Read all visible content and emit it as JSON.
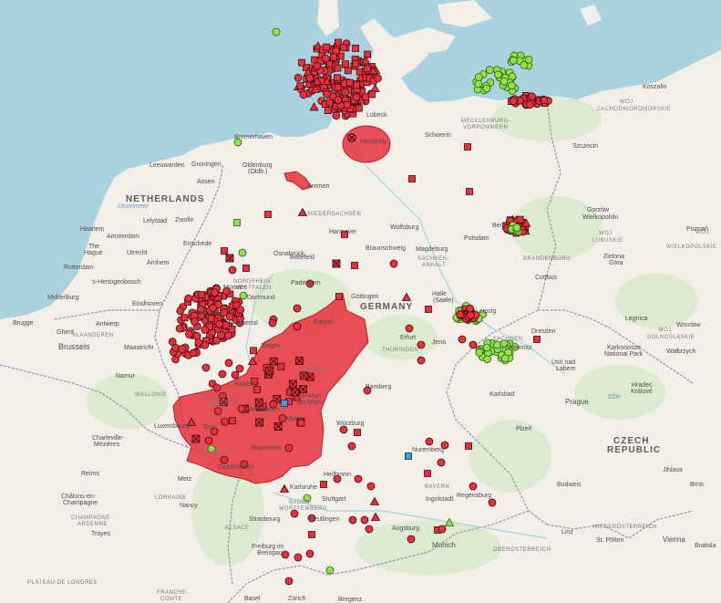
{
  "map": {
    "colors": {
      "sea": "#aad3df",
      "land": "#f2efe9",
      "forest": "#dcead0",
      "border": "#9b8fb5",
      "highlight_fill": "#e8303c",
      "marker_red": "#e8303c",
      "marker_green": "#8ee34a",
      "marker_blue": "#3aa0dd"
    },
    "marker_types": [
      "circle",
      "square",
      "triangle",
      "crossed-square"
    ],
    "countries": {
      "germany": "GERMANY",
      "netherlands": "NETHERLANDS",
      "czech1": "CZECH",
      "czech2": "REPUBLIC"
    },
    "regions": {
      "mecklenburg1": "MECKLENBURG-",
      "mecklenburg2": "VORPOMMERN",
      "zachodniopomorskie": "ZACHODNIOPOMORSKIE",
      "niedersachsen": "NIEDERSACHSEN",
      "brandenburg": "BRANDENBURG",
      "nordrhein1": "NORDRHEIN-",
      "nordrhein2": "WESTFALEN",
      "sachsen_anhalt1": "SACHSEN-",
      "sachsen_anhalt2": "ANHALT",
      "hessen": "HESSEN",
      "thuringen": "THÜRINGEN",
      "sachsen": "SACHSEN",
      "rheinland1": "RHEINLAND-",
      "rheinland2": "PFALZ",
      "saarland": "SAARLAND",
      "bayern": "BAYERN",
      "baden1": "BADEN-",
      "baden2": "WÜRTTEMBERG",
      "vlaanderen": "VLAANDEREN",
      "wallonie": "WALLONIE",
      "lorraine": "LORRAINE",
      "champagne1": "CHAMPAGNE-",
      "champagne2": "ARDENNE",
      "alsace": "ALSACE",
      "franche1": "FRANCHE-",
      "franche2": "COMTE",
      "plateau": "PLATEAU DE LONGRES",
      "woj1": "WOJ",
      "woj1b": "ZACHODNIOPOMORSKIE",
      "woj2": "WOJ",
      "woj2b": "WIELKOPOLSKIE",
      "woj3": "WOJ",
      "woj3b": "LUBUSKIE",
      "woj4": "WOJ",
      "woj4b": "DOLNOŚLĄSKIE",
      "niederosterreich": "NIEDERÖSTERREICH",
      "oberosterreich": "OBERÖSTERREICH"
    },
    "cities": {
      "bremerhaven": "Bremerhaven",
      "lubeck": "Lübeck",
      "hamburg": "Hamburg",
      "schwerin": "Schwerin",
      "szczecin": "Szczecin",
      "koszalin": "Koszalin",
      "leeuwarden": "Leeuwarden",
      "groningen": "Groningen",
      "oldenburg": "Oldenburg",
      "oldenburg2": "(Oldb.)",
      "assen": "Assen",
      "bremen": "Bremen",
      "haarlem": "Haarlem",
      "lelystad": "Lelystad",
      "zwolle": "Zwolle",
      "amsterdam": "Amsterdam",
      "hannover": "Hannover",
      "wolfsburg": "Wolfsburg",
      "berlin": "Berlin",
      "gorzow1": "Gorzów",
      "gorzow2": "Wielkopolski",
      "poznan": "Poznań",
      "thehague1": "The",
      "thehague2": "Hague",
      "utrecht": "Utrecht",
      "enschede": "Enschede",
      "osnabruck": "Osnabrück",
      "braunschweig": "Braunschweig",
      "magdeburg": "Magdeburg",
      "potsdam": "Potsdam",
      "rotterdam": "Rotterdam",
      "arnhem": "Arnhem",
      "bielefeld": "Bielefeld",
      "zielona1": "Zielona",
      "zielona2": "Góra",
      "hertogenbosch": "'s-Hertogenbosch",
      "munster": "Münster",
      "paderborn": "Paderborn",
      "gottingen": "Göttingen",
      "cottbus": "Cottbus",
      "middelburg": "Middelburg",
      "eindhoven": "Eindhoven",
      "dortmund": "Dortmund",
      "halle1": "Halle",
      "halle2": "(Saale)",
      "leipzig": "Leipzig",
      "antwerp": "Antwerp",
      "duisburg": "Duisburg",
      "wuppertal": "Wuppertal",
      "kassel": "Kassel",
      "legnica": "Legnica",
      "wroclaw": "Wrocław",
      "brugge": "Brugge",
      "ghent": "Ghent",
      "brussels": "Brussels",
      "maastricht": "Maastricht",
      "erfurt": "Erfurt",
      "jena": "Jena",
      "dresden": "Dresden",
      "chemnitz": "Chemnitz",
      "siegen": "Siegen",
      "walbrzych": "Wałbrzych",
      "karkonosze1": "Karkonosze",
      "karkonosze2": "National Park",
      "usti1": "Ústí nad",
      "usti2": "Labem",
      "namur": "Namur",
      "koblenz": "Koblenz",
      "frankfurt1": "Frankfurt",
      "frankfurt2": "am Main",
      "wiesbaden": "Wiesbaden",
      "mainz": "Mainz",
      "bamberg": "Bamberg",
      "karlsbad": "Karlsbad",
      "hradec1": "Hradec",
      "hradec2": "Králové",
      "prague": "Prague",
      "trier": "Trier",
      "wurzburg": "Würzburg",
      "luxembourg": "Luxembourg",
      "charleville1": "Charleville-",
      "charleville2": "Mézières",
      "mannheim": "Mannheim",
      "plzen": "Plzeň",
      "nuremberg": "Nuremberg",
      "saarbrucken": "Saarbrücken",
      "reims": "Reims",
      "metz": "Metz",
      "heilbronn": "Heilbronn",
      "karlsruhe": "Karlsruhe",
      "regensburg": "Regensburg",
      "jihlava": "Jihlava",
      "brno": "Brno",
      "chalons1": "Châlons-en-",
      "chalons2": "Champagne",
      "nancy": "Nancy",
      "stuttgart": "Stuttgart",
      "ingolstadt": "Ingolstadt",
      "budweis": "Budweis",
      "strasbourg": "Strasbourg",
      "reutlingen": "Reutlingen",
      "augsburg": "Augsburg",
      "linz": "Linz",
      "troyes": "Troyes",
      "munich": "Munich",
      "stpolten": "St. Pölten",
      "vienna": "Vienna",
      "bratislava": "Bratisla",
      "freiburg1": "Freiburg im",
      "freiburg2": "Breisgau",
      "basel": "Basel",
      "zurich": "Zürich",
      "bregenz": "Bregenz"
    },
    "seas": {
      "ijsselmeer": "IJsselmeer",
      "elbe": "Elbe"
    }
  }
}
